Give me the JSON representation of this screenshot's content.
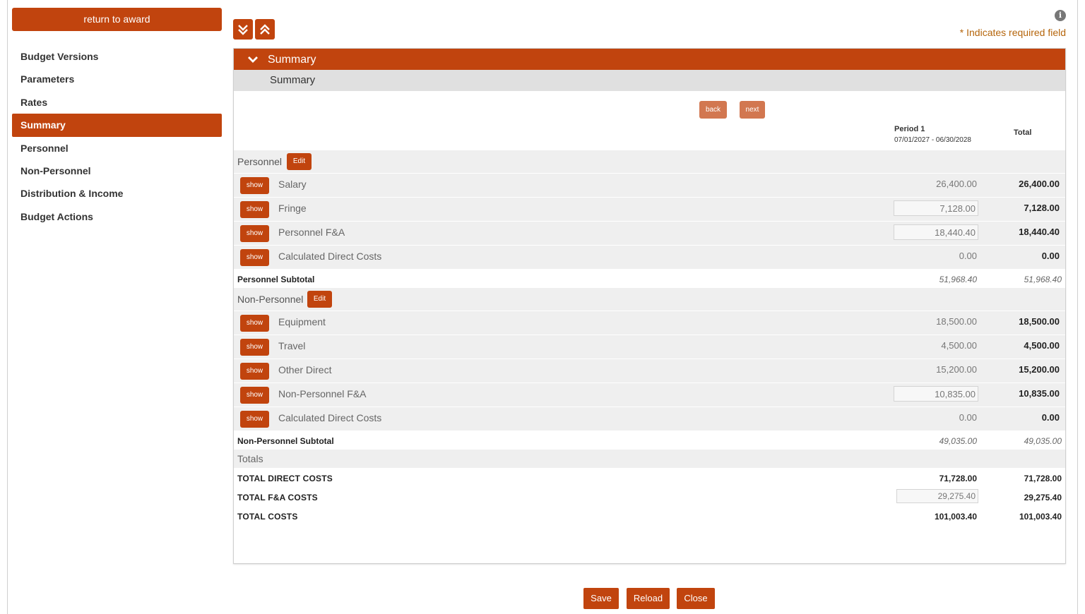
{
  "sidebar": {
    "return_label": "return to award",
    "items": [
      {
        "label": "Budget Versions"
      },
      {
        "label": "Parameters"
      },
      {
        "label": "Rates"
      },
      {
        "label": "Summary"
      },
      {
        "label": "Personnel"
      },
      {
        "label": "Non-Personnel"
      },
      {
        "label": "Distribution & Income"
      },
      {
        "label": "Budget Actions"
      }
    ],
    "active_item": "Summary"
  },
  "header": {
    "info_icon": "i",
    "required_note": "* Indicates required field"
  },
  "panel": {
    "title": "Summary",
    "subtitle": "Summary",
    "back_label": "back",
    "next_label": "next",
    "period_label": "Period 1",
    "period_range": "07/01/2027 - 06/30/2028",
    "total_label": "Total"
  },
  "personnel": {
    "label": "Personnel",
    "edit_label": "Edit",
    "show_label": "show",
    "lines": [
      {
        "label": "Salary",
        "period": "26,400.00",
        "total": "26,400.00"
      },
      {
        "label": "Fringe",
        "period": "7,128.00",
        "total": "7,128.00"
      },
      {
        "label": "Personnel F&A",
        "period": "18,440.40",
        "total": "18,440.40"
      },
      {
        "label": "Calculated Direct Costs",
        "period": "0.00",
        "total": "0.00"
      }
    ],
    "subtotal_label": "Personnel Subtotal",
    "subtotal_period": "51,968.40",
    "subtotal_total": "51,968.40"
  },
  "nonpersonnel": {
    "label": "Non-Personnel",
    "edit_label": "Edit",
    "show_label": "show",
    "lines": [
      {
        "label": "Equipment",
        "period": "18,500.00",
        "total": "18,500.00"
      },
      {
        "label": "Travel",
        "period": "4,500.00",
        "total": "4,500.00"
      },
      {
        "label": "Other Direct",
        "period": "15,200.00",
        "total": "15,200.00"
      },
      {
        "label": "Non-Personnel F&A",
        "period": "10,835.00",
        "total": "10,835.00"
      },
      {
        "label": "Calculated Direct Costs",
        "period": "0.00",
        "total": "0.00"
      }
    ],
    "subtotal_label": "Non-Personnel Subtotal",
    "subtotal_period": "49,035.00",
    "subtotal_total": "49,035.00"
  },
  "totals": {
    "label": "Totals",
    "direct_label": "TOTAL DIRECT COSTS",
    "direct_period": "71,728.00",
    "direct_total": "71,728.00",
    "fa_label": "TOTAL F&A COSTS",
    "fa_period": "29,275.40",
    "fa_total": "29,275.40",
    "costs_label": "TOTAL COSTS",
    "costs_period": "101,003.40",
    "costs_total": "101,003.40"
  },
  "footer": {
    "save_label": "Save",
    "reload_label": "Reload",
    "close_label": "Close"
  },
  "colors": {
    "accent": "#c1440e",
    "required_text": "#b5650b"
  }
}
